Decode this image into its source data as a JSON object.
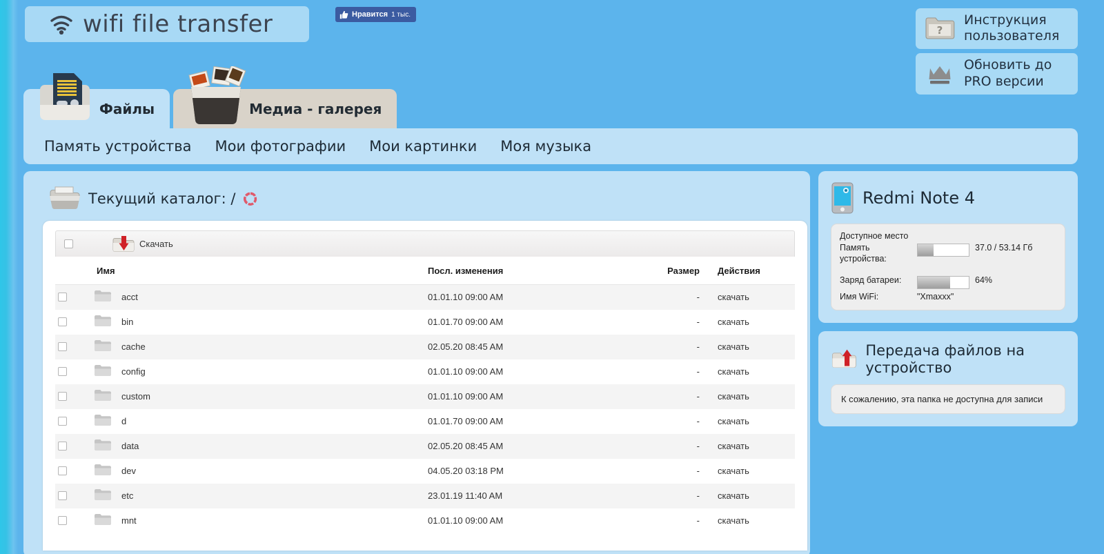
{
  "app": {
    "logo_text": "wifi file transfer",
    "wifi_icon": "wifi-icon"
  },
  "facebook": {
    "like_label": "Нравится",
    "like_count": "1 тыс.",
    "thumb_icon": "thumbs-up-icon"
  },
  "header_actions": [
    {
      "label": "Инструкция\nпользователя",
      "icon": "help-folder-icon"
    },
    {
      "label": "Обновить до\nPRO версии",
      "icon": "crown-icon"
    }
  ],
  "tabs": [
    {
      "label": "Файлы",
      "icon": "sd-card-folder-icon",
      "active": true
    },
    {
      "label": "Медиа - галерея",
      "icon": "media-gallery-icon",
      "active": false
    }
  ],
  "nav": {
    "items": [
      {
        "label": "Память устройства"
      },
      {
        "label": "Мои фотографии"
      },
      {
        "label": "Мои картинки"
      },
      {
        "label": "Моя музыка"
      }
    ]
  },
  "directory": {
    "label": "Текущий каталог:",
    "path": "/",
    "folder_icon": "open-folder-icon",
    "refresh_icon": "refresh-icon"
  },
  "toolbar": {
    "download_label": "Скачать",
    "download_icon": "download-folder-icon"
  },
  "table": {
    "columns": {
      "name": "Имя",
      "modified": "Посл. изменения",
      "size": "Размер",
      "actions": "Действия"
    },
    "action_label": "скачать",
    "rows": [
      {
        "name": "acct",
        "modified": "01.01.10 09:00 AM",
        "size": "-",
        "action": "скачать",
        "icon": "folder-icon"
      },
      {
        "name": "bin",
        "modified": "01.01.70 09:00 AM",
        "size": "-",
        "action": "скачать",
        "icon": "folder-icon"
      },
      {
        "name": "cache",
        "modified": "02.05.20 08:45 AM",
        "size": "-",
        "action": "скачать",
        "icon": "folder-icon"
      },
      {
        "name": "config",
        "modified": "01.01.10 09:00 AM",
        "size": "-",
        "action": "скачать",
        "icon": "folder-icon"
      },
      {
        "name": "custom",
        "modified": "01.01.10 09:00 AM",
        "size": "-",
        "action": "скачать",
        "icon": "folder-icon"
      },
      {
        "name": "d",
        "modified": "01.01.70 09:00 AM",
        "size": "-",
        "action": "скачать",
        "icon": "folder-icon"
      },
      {
        "name": "data",
        "modified": "02.05.20 08:45 AM",
        "size": "-",
        "action": "скачать",
        "icon": "folder-icon"
      },
      {
        "name": "dev",
        "modified": "04.05.20 03:18 PM",
        "size": "-",
        "action": "скачать",
        "icon": "folder-icon"
      },
      {
        "name": "etc",
        "modified": "23.01.19 11:40 AM",
        "size": "-",
        "action": "скачать",
        "icon": "folder-icon"
      },
      {
        "name": "mnt",
        "modified": "01.01.10 09:00 AM",
        "size": "-",
        "action": "скачать",
        "icon": "folder-icon"
      }
    ]
  },
  "device": {
    "name": "Redmi Note 4",
    "icon": "phone-icon",
    "available_space_label": "Доступное место",
    "storage_label": "Память устройства:",
    "storage_value": "37.0 / 53.14 Гб",
    "storage_percent": 31,
    "battery_label": "Заряд батареи:",
    "battery_value": "64%",
    "battery_percent": 64,
    "wifi_label": "Имя WiFi:",
    "wifi_value": "\"Xmaxxx\""
  },
  "upload": {
    "title": "Передача файлов на устройство",
    "icon": "upload-folder-icon",
    "message": "К сожалению, эта папка не доступна для записи"
  },
  "colors": {
    "page_bg": "#5cb4ec",
    "panel_bg": "#bfe1f7",
    "logo_bg": "#a8d9f5",
    "tab_active": "#bfe1f7",
    "tab_inactive": "#d9d3c9",
    "fb_blue": "#3b5ba1",
    "refresh_red": "#e05a6b"
  }
}
